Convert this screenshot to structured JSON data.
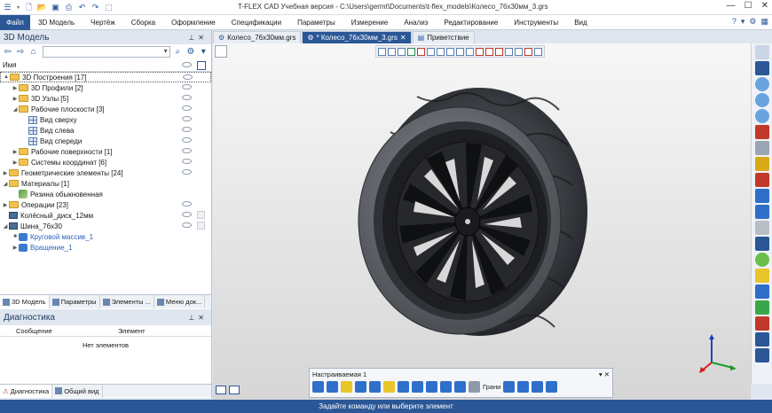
{
  "window": {
    "title": "T-FLEX CAD Учебная версия - C:\\Users\\germt\\Documents\\t-flex_models\\Колесо_76x30мм_3.grs",
    "controls": [
      "—",
      "☐",
      "✕"
    ]
  },
  "quick_access": {
    "icons": [
      "menu-icon",
      "new-icon",
      "open-icon",
      "save-icon",
      "print-icon",
      "undo-icon",
      "redo-icon",
      "select-icon"
    ]
  },
  "menu": {
    "file": "Файл",
    "items": [
      "3D Модель",
      "Чертёж",
      "Сборка",
      "Оформление",
      "Спецификации",
      "Параметры",
      "Измерение",
      "Анализ",
      "Редактирование",
      "Инструменты",
      "Вид"
    ]
  },
  "model_panel": {
    "title": "3D Модель",
    "column_name": "Имя",
    "tree": [
      {
        "label": "3D Построения [17]",
        "icon": "folder",
        "level": 0,
        "exp": "▲",
        "selected": true,
        "eye": true
      },
      {
        "label": "3D Профили [2]",
        "icon": "folder",
        "level": 1,
        "exp": "▶",
        "eye": true
      },
      {
        "label": "3D Узлы [5]",
        "icon": "folder",
        "level": 1,
        "exp": "▶",
        "eye": true
      },
      {
        "label": "Рабочие плоскости [3]",
        "icon": "folder",
        "level": 1,
        "exp": "◢",
        "eye": true
      },
      {
        "label": "Вид сверху",
        "icon": "plane",
        "level": 2,
        "exp": "",
        "eye": true
      },
      {
        "label": "Вид слева",
        "icon": "plane",
        "level": 2,
        "exp": "",
        "eye": true
      },
      {
        "label": "Вид спереди",
        "icon": "plane",
        "level": 2,
        "exp": "",
        "eye": true
      },
      {
        "label": "Рабочие поверхности [1]",
        "icon": "folder",
        "level": 1,
        "exp": "▶",
        "eye": true
      },
      {
        "label": "Системы координат [6]",
        "icon": "folder",
        "level": 1,
        "exp": "▶",
        "eye": true
      },
      {
        "label": "Геометрические элементы [24]",
        "icon": "folder",
        "level": 0,
        "exp": "▶",
        "eye": true
      },
      {
        "label": "Материалы [1]",
        "icon": "folder",
        "level": 0,
        "exp": "◢",
        "eye": false
      },
      {
        "label": "Резина обыкновенная",
        "icon": "material",
        "level": 1,
        "exp": "",
        "eye": false
      },
      {
        "label": "Операции [23]",
        "icon": "folder",
        "level": 0,
        "exp": "▶",
        "eye": true
      },
      {
        "label": "Колёсный_диск_12мм",
        "icon": "body",
        "level": 0,
        "exp": "",
        "eye": true,
        "dup": true
      },
      {
        "label": "Шина_76x30",
        "icon": "body",
        "level": 0,
        "exp": "◢",
        "eye": true,
        "dup": true
      },
      {
        "label": "Круговой массив_1",
        "icon": "op",
        "level": 1,
        "exp": "■",
        "eye": false,
        "blue": true
      },
      {
        "label": "Вращение_1",
        "icon": "op",
        "level": 1,
        "exp": "▶",
        "eye": false,
        "blue": true
      }
    ],
    "tabs": [
      "3D Модель",
      "Параметры",
      "Элементы ...",
      "Меню док..."
    ]
  },
  "diagnostics": {
    "title": "Диагностика",
    "columns": [
      "Сообщение",
      "Элемент"
    ],
    "empty_text": "Нет элементов",
    "tabs": [
      "Диагностика",
      "Общий вид"
    ]
  },
  "doc_tabs": [
    {
      "label": "Колесо_76x30мм.grs",
      "active": false
    },
    {
      "label": "* Колесо_76x30мм_3.grs",
      "active": true
    },
    {
      "label": "Приветствие",
      "active": false
    }
  ],
  "custom_toolbar": {
    "title": "Настраиваемая 1",
    "faces_label": "Грани"
  },
  "status": {
    "prompt": "Задайте команду или выберите элемент"
  },
  "colors": {
    "accent": "#2b5797",
    "tire": "#3a3d42",
    "rim": "#1d1e21"
  }
}
